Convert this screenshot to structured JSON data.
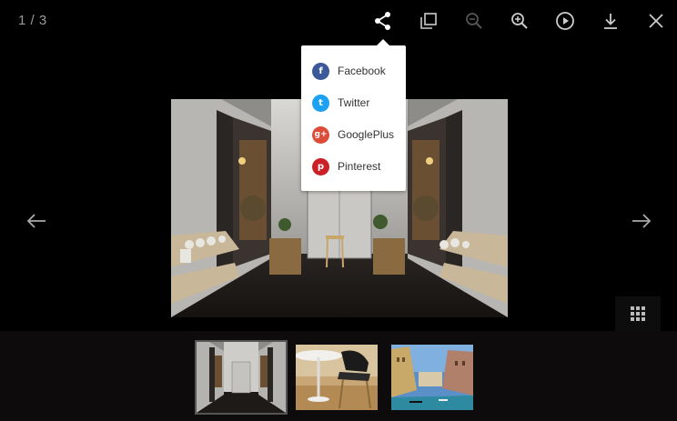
{
  "counter": "1 / 3",
  "toolbar": {
    "share_icon": "share-icon",
    "actual_size_icon": "actual-size-icon",
    "zoom_out_icon": "zoom-out-icon",
    "zoom_in_icon": "zoom-in-icon",
    "autoplay_icon": "play-icon",
    "download_icon": "download-icon",
    "close_icon": "close-icon"
  },
  "share_menu": {
    "items": [
      {
        "label": "Facebook",
        "glyph": "f",
        "color": "#3b5998"
      },
      {
        "label": "Twitter",
        "glyph": "t",
        "color": "#1da1f2"
      },
      {
        "label": "GooglePlus",
        "glyph": "g+",
        "color": "#dd4b39"
      },
      {
        "label": "Pinterest",
        "glyph": "p",
        "color": "#cb2027"
      }
    ]
  },
  "colors": {
    "background": "#000000",
    "toolbar_icon": "#cccccc",
    "toolbar_icon_disabled": "#555555",
    "thumb_strip": "#0d0b0c"
  },
  "thumbnails": [
    {
      "name": "restaurant-interior",
      "active": true
    },
    {
      "name": "chair-and-table",
      "active": false
    },
    {
      "name": "venice-canal",
      "active": false
    }
  ]
}
